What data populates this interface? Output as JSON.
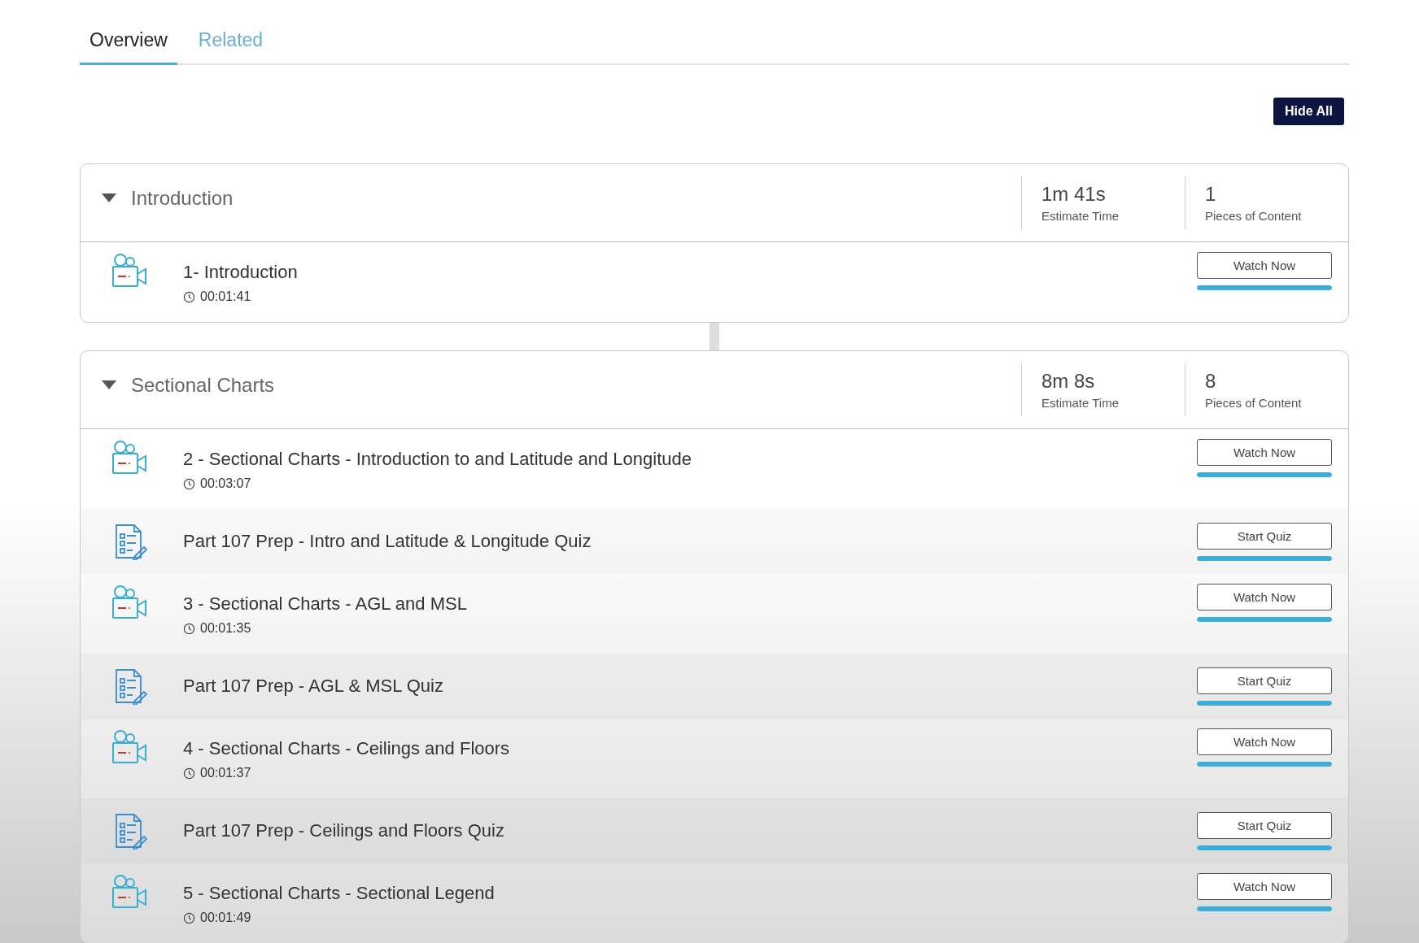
{
  "tabs": [
    {
      "label": "Overview",
      "selected": true
    },
    {
      "label": "Related",
      "selected": false
    }
  ],
  "hide_all_button": "Hide All",
  "sections": [
    {
      "title": "Introduction",
      "expanded": true,
      "estimate_time": "1m 41s",
      "estimate_label": "Estimate Time",
      "pieces": "1",
      "pieces_label": "Pieces of Content",
      "items": [
        {
          "kind": "video",
          "title": "1- Introduction",
          "duration": "00:01:41",
          "button": "Watch Now",
          "level": 1
        }
      ]
    },
    {
      "title": "Sectional Charts",
      "expanded": true,
      "estimate_time": "8m 8s",
      "estimate_label": "Estimate Time",
      "pieces": "8",
      "pieces_label": "Pieces of Content",
      "items": [
        {
          "kind": "video",
          "title": "2 - Sectional Charts - Introduction to and Latitude and Longitude",
          "duration": "00:03:07",
          "button": "Watch Now",
          "level": 1
        },
        {
          "kind": "quiz",
          "title": "Part 107 Prep - Intro and Latitude & Longitude Quiz",
          "button": "Start Quiz",
          "level": 1
        },
        {
          "kind": "video",
          "title": "3 - Sectional Charts - AGL and MSL",
          "duration": "00:01:35",
          "button": "Watch Now",
          "level": 1
        },
        {
          "kind": "quiz",
          "title": "Part 107 Prep - AGL & MSL Quiz",
          "button": "Start Quiz",
          "level": 1
        },
        {
          "kind": "video",
          "title": "4 - Sectional Charts - Ceilings and Floors",
          "duration": "00:01:37",
          "button": "Watch Now",
          "level": 1
        },
        {
          "kind": "quiz",
          "title": "Part 107 Prep - Ceilings and Floors Quiz",
          "button": "Start Quiz",
          "level": 1
        },
        {
          "kind": "video",
          "title": "5 - Sectional Charts - Sectional Legend",
          "duration": "00:01:49",
          "button": "Watch Now",
          "level": 1
        }
      ]
    }
  ]
}
